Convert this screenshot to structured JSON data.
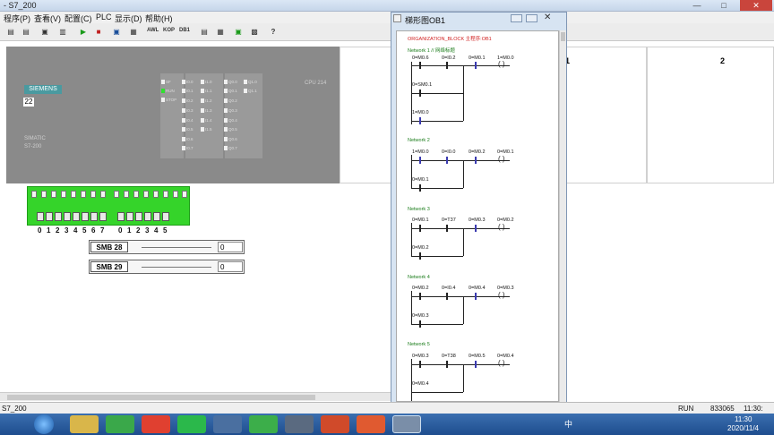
{
  "window": {
    "title": "- S7_200",
    "min": "—",
    "max": "□",
    "close": "✕"
  },
  "menu": [
    "程序(P)",
    "查看(V)",
    "配置(C)",
    "PLC",
    "显示(D)",
    "帮助(H)"
  ],
  "toolbar": {
    "awl": "AWL",
    "kop": "KOP",
    "db1": "DB1",
    "help": "?"
  },
  "plc": {
    "brand": "SIEMENS",
    "station": "22",
    "model_line1": "SIMATIC",
    "model_line2": "S7-200",
    "cpu": "CPU 214",
    "status_labels": [
      "SF",
      "RUN",
      "STOP"
    ],
    "inputs_col1": [
      "I0.0",
      "I0.1",
      "I0.2",
      "I0.3",
      "I0.4",
      "I0.5",
      "I0.6",
      "I0.7"
    ],
    "inputs_col2": [
      "I1.0",
      "I1.1",
      "I1.2",
      "I1.3",
      "I1.4",
      "I1.5"
    ],
    "outputs_col1": [
      "Q0.0",
      "Q0.1",
      "Q0.2",
      "Q0.3",
      "Q0.4",
      "Q0.5",
      "Q0.6",
      "Q0.7"
    ],
    "outputs_col2": [
      "Q1.0",
      "Q1.1"
    ]
  },
  "panels": {
    "p1": "1",
    "p2": "2"
  },
  "switch_numbers_a": [
    "0",
    "1",
    "2",
    "3",
    "4",
    "5",
    "6",
    "7"
  ],
  "switch_numbers_b": [
    "0",
    "1",
    "2",
    "3",
    "4",
    "5"
  ],
  "smb": [
    {
      "label": "SMB 28",
      "value": "0"
    },
    {
      "label": "SMB 29",
      "value": "0"
    }
  ],
  "statusbar": {
    "left": "S7_200",
    "mode": "RUN",
    "counter": "833065",
    "time": "11:30:"
  },
  "taskbar": {
    "time": "11:30",
    "date": "2020/11/4",
    "ime": "中"
  },
  "ladder": {
    "title": "梯形图OB1",
    "header": "ORGANIZATION_BLOCK 主程序:OB1",
    "networks": [
      {
        "name": "Network 1 // 网络标题",
        "row1": [
          "0=M0.6",
          "0=I0.2",
          "0=M0.1",
          "1=M0.0"
        ],
        "row2": "0=SM0.1",
        "row3": "1=M0.0"
      },
      {
        "name": "Network 2",
        "row1": [
          "1=M0.0",
          "0=I0.0",
          "0=M0.2",
          "0=M0.1"
        ],
        "row2": "0=M0.1"
      },
      {
        "name": "Network 3",
        "row1": [
          "0=M0.1",
          "0=T37",
          "0=M0.3",
          "0=M0.2"
        ],
        "row2": "0=M0.2"
      },
      {
        "name": "Network 4",
        "row1": [
          "0=M0.2",
          "0=I0.4",
          "0=M0.4",
          "0=M0.3"
        ],
        "row2": "0=M0.3"
      },
      {
        "name": "Network 5",
        "row1": [
          "0=M0.3",
          "0=T38",
          "0=M0.5",
          "0=M0.4"
        ],
        "row2": "0=M0.4"
      }
    ]
  },
  "colors": {
    "plc_body": "#8a8a8a",
    "switch_green": "#35d42a",
    "network_green": "#1c7d1c",
    "header_red": "#d02020"
  }
}
